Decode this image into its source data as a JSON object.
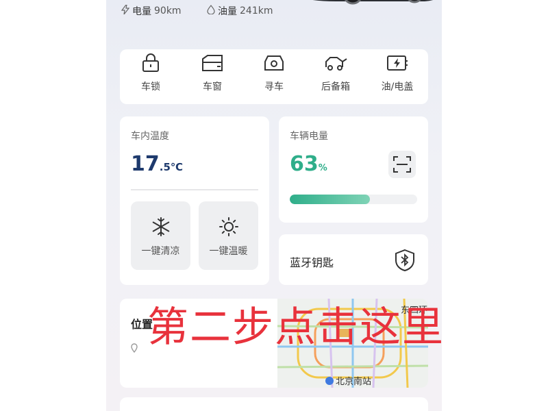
{
  "header": {
    "battery_stat": {
      "label": "电量",
      "value": "90km"
    },
    "fuel_stat": {
      "label": "油量",
      "value": "241km"
    }
  },
  "shortcuts": [
    {
      "label": "车锁",
      "icon": "lock-icon"
    },
    {
      "label": "车窗",
      "icon": "window-icon"
    },
    {
      "label": "寻车",
      "icon": "find-car-icon"
    },
    {
      "label": "后备箱",
      "icon": "trunk-icon"
    },
    {
      "label": "油/电盖",
      "icon": "fuel-cap-icon"
    }
  ],
  "cabin_temp": {
    "label": "车内温度",
    "value_int": "17",
    "value_frac": ".5",
    "unit": "℃",
    "cool_button": "一键清凉",
    "warm_button": "一键温暖"
  },
  "battery": {
    "label": "车辆电量",
    "value": "63",
    "unit": "%",
    "level": 0.63,
    "accent": "#2fae8a"
  },
  "bluetooth_key": {
    "label": "蓝牙钥匙"
  },
  "location": {
    "title": "位置",
    "map_labels": {
      "ring_road": "东四环",
      "station": "北京南站"
    }
  },
  "annotation": {
    "text": "第二步点击这里",
    "color": "#e8323c"
  }
}
